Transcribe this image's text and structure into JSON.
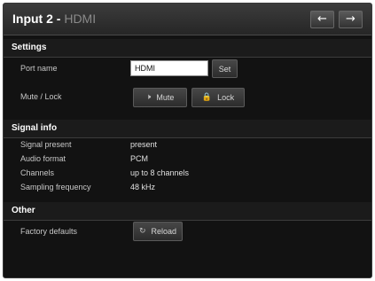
{
  "header": {
    "title": "Input 2 -",
    "subtitle": "HDMI",
    "prev_icon": "arrow-left-icon",
    "next_icon": "arrow-right-icon"
  },
  "settings": {
    "heading": "Settings",
    "port_name_label": "Port name",
    "port_name_value": "HDMI",
    "set_button": "Set",
    "mute_lock_label": "Mute / Lock",
    "mute_button": "Mute",
    "lock_button": "Lock",
    "mute_icon": "speaker-mute-icon",
    "lock_icon": "lock-icon"
  },
  "signal_info": {
    "heading": "Signal info",
    "rows": [
      {
        "label": "Signal present",
        "value": "present"
      },
      {
        "label": "Audio format",
        "value": "PCM"
      },
      {
        "label": "Channels",
        "value": "up to 8 channels"
      },
      {
        "label": "Sampling frequency",
        "value": "48 kHz"
      }
    ]
  },
  "other": {
    "heading": "Other",
    "factory_label": "Factory defaults",
    "reload_button": "Reload",
    "reload_icon": "reload-icon"
  }
}
